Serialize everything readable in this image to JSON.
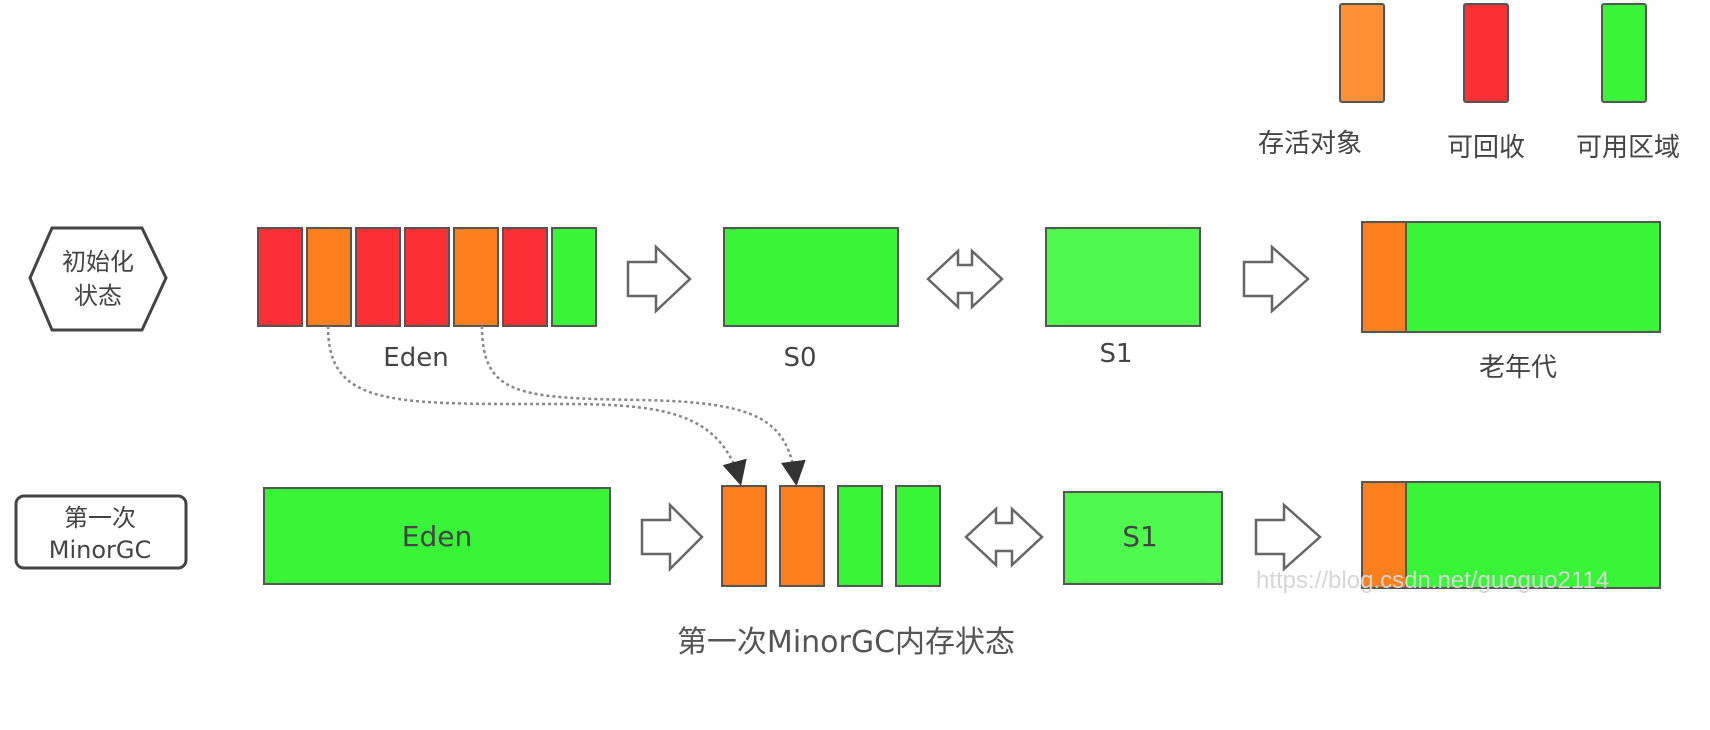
{
  "colors": {
    "survive": "#ff9035",
    "survive_dark": "#fc7f1e",
    "recyclable": "#fc2f35",
    "available": "#38f538",
    "available_light": "#4dfa4d",
    "border": "#555555",
    "arrow_fill": "#ffffff",
    "arrow_stroke": "#666666",
    "dotted": "#888888"
  },
  "legend": {
    "survive": "存活对象",
    "recyclable": "可回收",
    "available": "可用区域"
  },
  "row1": {
    "badge": {
      "line1": "初始化",
      "line2": "状态"
    },
    "eden_blocks": [
      "recyclable",
      "survive",
      "recyclable",
      "recyclable",
      "survive",
      "recyclable",
      "available"
    ],
    "eden_label": "Eden",
    "s0_label": "S0",
    "s1_label": "S1",
    "old_label": "老年代"
  },
  "row2": {
    "badge": {
      "line1": "第一次",
      "line2": "MinorGC"
    },
    "eden_label": "Eden",
    "s0_blocks": [
      "survive",
      "survive",
      "available",
      "available"
    ],
    "s1_label": "S1"
  },
  "caption": "第一次MinorGC内存状态",
  "watermark": "https://blog.csdn.net/guoguo2114"
}
